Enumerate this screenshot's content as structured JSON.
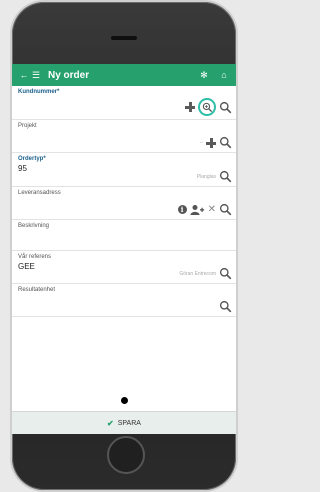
{
  "appbar": {
    "title": "Ny order",
    "back_icon": "arrow-left-icon",
    "menu_icon": "hamburger-icon",
    "bug_icon": "bug-icon",
    "home_icon": "home-icon"
  },
  "fields": {
    "kundnummer": {
      "label": "Kundnummer*",
      "value": ""
    },
    "projekt": {
      "label": "Projekt",
      "value": "",
      "hint": "--"
    },
    "ordertyp": {
      "label": "Ordertyp*",
      "value": "95",
      "hint": "Planglas"
    },
    "leveransadress": {
      "label": "Leveransadress",
      "value": ""
    },
    "beskrivning": {
      "label": "Beskrivning",
      "value": ""
    },
    "var_referens": {
      "label": "Vår referens",
      "value": "GEE",
      "hint": "Göran Entrecom"
    },
    "resultatenhet": {
      "label": "Resultatenhet",
      "value": ""
    }
  },
  "footer": {
    "save_label": "SPARA"
  },
  "colors": {
    "brand": "#26a06d",
    "highlight_ring": "#2dbfa8"
  }
}
